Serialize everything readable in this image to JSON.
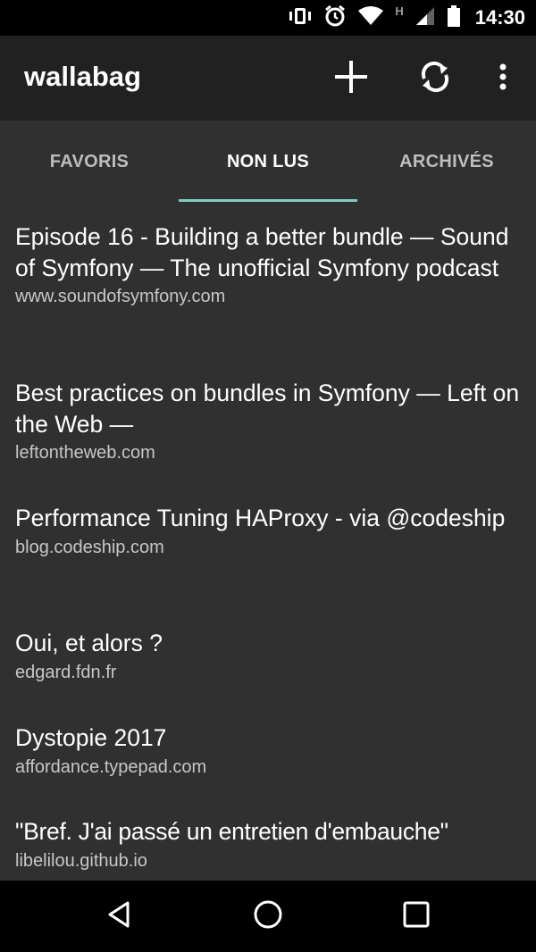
{
  "status_bar": {
    "time": "14:30",
    "icons": [
      "vibrate-icon",
      "alarm-icon",
      "wifi-icon",
      "h-network-icon",
      "signal-icon",
      "battery-icon"
    ],
    "network_label": "H"
  },
  "app_bar": {
    "title": "wallabag",
    "actions": [
      "add-icon",
      "sync-icon",
      "overflow-menu-icon"
    ]
  },
  "tabs": [
    {
      "label": "FAVORIS",
      "active": false
    },
    {
      "label": "NON LUS",
      "active": true
    },
    {
      "label": "ARCHIVÉS",
      "active": false
    }
  ],
  "articles": [
    {
      "title": "Episode 16 - Building a better bundle — Sound of Symfony — The unofficial Symfony podcast",
      "domain": "www.soundofsymfony.com"
    },
    {
      "title": "Best practices on bundles in Symfony — Left on the Web —",
      "domain": "leftontheweb.com"
    },
    {
      "title": "Performance Tuning HAProxy - via @codeship",
      "domain": "blog.codeship.com"
    },
    {
      "title": "Oui, et alors ?",
      "domain": "edgard.fdn.fr"
    },
    {
      "title": "Dystopie 2017",
      "domain": "affordance.typepad.com"
    },
    {
      "title": "\"Bref. J'ai passé un entretien d'embauche\"",
      "domain": "libelilou.github.io"
    }
  ],
  "nav_bar": {
    "buttons": [
      "back-icon",
      "home-icon",
      "recents-icon"
    ]
  },
  "colors": {
    "background": "#303030",
    "app_bar": "#212121",
    "tab_indicator": "#80cbc4",
    "secondary_text": "#c7c7c7"
  }
}
